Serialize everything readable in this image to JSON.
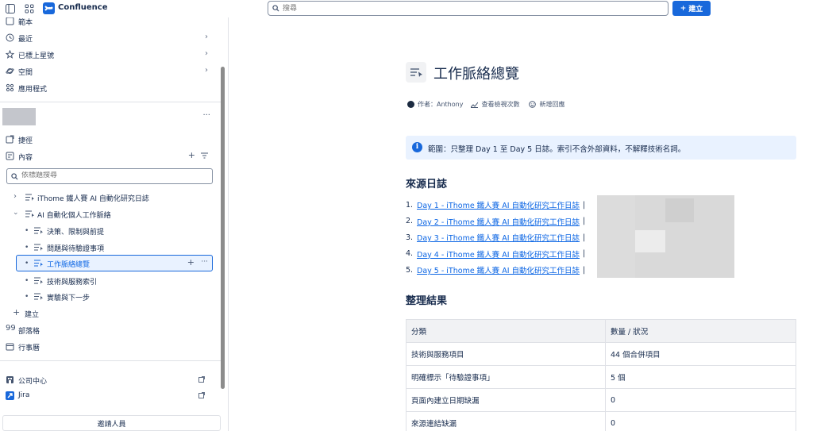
{
  "topbar": {
    "brand": "Confluence",
    "search_placeholder": "搜尋",
    "create_label": "建立"
  },
  "sidebar": {
    "partial_top": "範本",
    "nav": [
      {
        "label": "最近",
        "icon": "clock-icon"
      },
      {
        "label": "已標上星號",
        "icon": "star-icon"
      },
      {
        "label": "空間",
        "icon": "planet-icon"
      },
      {
        "label": "應用程式",
        "icon": "apps-icon"
      }
    ],
    "more": "···",
    "shortcuts": "捷徑",
    "content": "內容",
    "filter_placeholder": "依標題搜尋",
    "tree": [
      {
        "label": "iThome 鐵人賽 AI 自動化研究日誌",
        "level": 0,
        "expanded": false
      },
      {
        "label": "AI 自動化個人工作脈絡",
        "level": 0,
        "expanded": true
      },
      {
        "label": "決策、限制與前提",
        "level": 1
      },
      {
        "label": "問題與待驗證事項",
        "level": 1
      },
      {
        "label": "工作脈絡總覽",
        "level": 1,
        "selected": true
      },
      {
        "label": "技術與服務索引",
        "level": 1
      },
      {
        "label": "實驗與下一步",
        "level": 1
      }
    ],
    "create": "建立",
    "blog": "部落格",
    "calendar": "行事曆",
    "company_hub": "公司中心",
    "jira": "Jira",
    "invite": "邀請人員"
  },
  "page": {
    "title": "工作脈絡總覽",
    "author": "作者：Anthony",
    "views": "查看檢視次數",
    "reactions": "新增回應",
    "panel_text": "範圍：只整理 Day 1 至 Day 5 日誌。索引不含外部資料，不解釋技術名詞。",
    "sources_heading": "來源日誌",
    "sources": [
      {
        "num": "1.",
        "title": "Day 1 - iThome 鐵人賽 AI 自動化研究工作日誌"
      },
      {
        "num": "2.",
        "title": "Day 2 - iThome 鐵人賽 AI 自動化研究工作日誌"
      },
      {
        "num": "3.",
        "title": "Day 3 - iThome 鐵人賽 AI 自動化研究工作日誌"
      },
      {
        "num": "4.",
        "title": "Day 4 - iThome 鐵人賽 AI 自動化研究工作日誌"
      },
      {
        "num": "5.",
        "title": "Day 5 - iThome 鐵人賽 AI 自動化研究工作日誌"
      }
    ],
    "pipe": "|",
    "results_heading": "整理結果",
    "table": {
      "headers": [
        "分類",
        "數量 / 狀況"
      ],
      "rows": [
        [
          "技術與服務項目",
          "44 個合併項目"
        ],
        [
          "明確標示「待驗證事項」",
          "5 個"
        ],
        [
          "頁面內建立日期缺漏",
          "0"
        ],
        [
          "來源連結缺漏",
          "0"
        ]
      ]
    }
  },
  "colors": {
    "accent": "#1868db",
    "link": "#0c66e4",
    "panel_bg": "#e9f2ff"
  }
}
